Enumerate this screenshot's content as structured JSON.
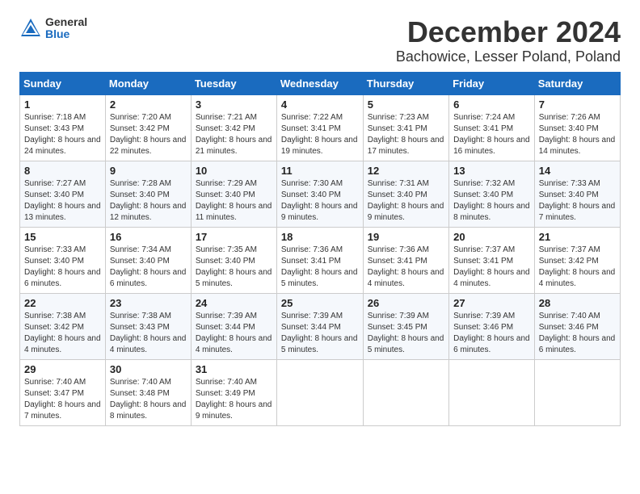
{
  "header": {
    "logo_general": "General",
    "logo_blue": "Blue",
    "month": "December 2024",
    "location": "Bachowice, Lesser Poland, Poland"
  },
  "days_of_week": [
    "Sunday",
    "Monday",
    "Tuesday",
    "Wednesday",
    "Thursday",
    "Friday",
    "Saturday"
  ],
  "weeks": [
    [
      {
        "day": "1",
        "sunrise": "7:18 AM",
        "sunset": "3:43 PM",
        "daylight": "8 hours and 24 minutes."
      },
      {
        "day": "2",
        "sunrise": "7:20 AM",
        "sunset": "3:42 PM",
        "daylight": "8 hours and 22 minutes."
      },
      {
        "day": "3",
        "sunrise": "7:21 AM",
        "sunset": "3:42 PM",
        "daylight": "8 hours and 21 minutes."
      },
      {
        "day": "4",
        "sunrise": "7:22 AM",
        "sunset": "3:41 PM",
        "daylight": "8 hours and 19 minutes."
      },
      {
        "day": "5",
        "sunrise": "7:23 AM",
        "sunset": "3:41 PM",
        "daylight": "8 hours and 17 minutes."
      },
      {
        "day": "6",
        "sunrise": "7:24 AM",
        "sunset": "3:41 PM",
        "daylight": "8 hours and 16 minutes."
      },
      {
        "day": "7",
        "sunrise": "7:26 AM",
        "sunset": "3:40 PM",
        "daylight": "8 hours and 14 minutes."
      }
    ],
    [
      {
        "day": "8",
        "sunrise": "7:27 AM",
        "sunset": "3:40 PM",
        "daylight": "8 hours and 13 minutes."
      },
      {
        "day": "9",
        "sunrise": "7:28 AM",
        "sunset": "3:40 PM",
        "daylight": "8 hours and 12 minutes."
      },
      {
        "day": "10",
        "sunrise": "7:29 AM",
        "sunset": "3:40 PM",
        "daylight": "8 hours and 11 minutes."
      },
      {
        "day": "11",
        "sunrise": "7:30 AM",
        "sunset": "3:40 PM",
        "daylight": "8 hours and 9 minutes."
      },
      {
        "day": "12",
        "sunrise": "7:31 AM",
        "sunset": "3:40 PM",
        "daylight": "8 hours and 9 minutes."
      },
      {
        "day": "13",
        "sunrise": "7:32 AM",
        "sunset": "3:40 PM",
        "daylight": "8 hours and 8 minutes."
      },
      {
        "day": "14",
        "sunrise": "7:33 AM",
        "sunset": "3:40 PM",
        "daylight": "8 hours and 7 minutes."
      }
    ],
    [
      {
        "day": "15",
        "sunrise": "7:33 AM",
        "sunset": "3:40 PM",
        "daylight": "8 hours and 6 minutes."
      },
      {
        "day": "16",
        "sunrise": "7:34 AM",
        "sunset": "3:40 PM",
        "daylight": "8 hours and 6 minutes."
      },
      {
        "day": "17",
        "sunrise": "7:35 AM",
        "sunset": "3:40 PM",
        "daylight": "8 hours and 5 minutes."
      },
      {
        "day": "18",
        "sunrise": "7:36 AM",
        "sunset": "3:41 PM",
        "daylight": "8 hours and 5 minutes."
      },
      {
        "day": "19",
        "sunrise": "7:36 AM",
        "sunset": "3:41 PM",
        "daylight": "8 hours and 4 minutes."
      },
      {
        "day": "20",
        "sunrise": "7:37 AM",
        "sunset": "3:41 PM",
        "daylight": "8 hours and 4 minutes."
      },
      {
        "day": "21",
        "sunrise": "7:37 AM",
        "sunset": "3:42 PM",
        "daylight": "8 hours and 4 minutes."
      }
    ],
    [
      {
        "day": "22",
        "sunrise": "7:38 AM",
        "sunset": "3:42 PM",
        "daylight": "8 hours and 4 minutes."
      },
      {
        "day": "23",
        "sunrise": "7:38 AM",
        "sunset": "3:43 PM",
        "daylight": "8 hours and 4 minutes."
      },
      {
        "day": "24",
        "sunrise": "7:39 AM",
        "sunset": "3:44 PM",
        "daylight": "8 hours and 4 minutes."
      },
      {
        "day": "25",
        "sunrise": "7:39 AM",
        "sunset": "3:44 PM",
        "daylight": "8 hours and 5 minutes."
      },
      {
        "day": "26",
        "sunrise": "7:39 AM",
        "sunset": "3:45 PM",
        "daylight": "8 hours and 5 minutes."
      },
      {
        "day": "27",
        "sunrise": "7:39 AM",
        "sunset": "3:46 PM",
        "daylight": "8 hours and 6 minutes."
      },
      {
        "day": "28",
        "sunrise": "7:40 AM",
        "sunset": "3:46 PM",
        "daylight": "8 hours and 6 minutes."
      }
    ],
    [
      {
        "day": "29",
        "sunrise": "7:40 AM",
        "sunset": "3:47 PM",
        "daylight": "8 hours and 7 minutes."
      },
      {
        "day": "30",
        "sunrise": "7:40 AM",
        "sunset": "3:48 PM",
        "daylight": "8 hours and 8 minutes."
      },
      {
        "day": "31",
        "sunrise": "7:40 AM",
        "sunset": "3:49 PM",
        "daylight": "8 hours and 9 minutes."
      },
      null,
      null,
      null,
      null
    ]
  ]
}
